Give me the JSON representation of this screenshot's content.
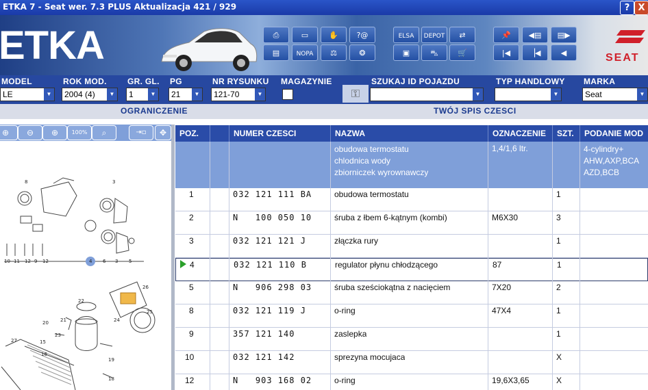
{
  "window": {
    "title": "ETKA 7 - Seat wer. 7.3 PLUS Aktualizacja 421 / 929",
    "help_button": "?",
    "close_button": "X"
  },
  "banner": {
    "logo": "ETKA",
    "brand": "SEAT",
    "icons": {
      "nopa": "NOPA",
      "elsa": "ELSA",
      "depot": "DEPOT"
    }
  },
  "filters": {
    "model": {
      "label": "MODEL",
      "value": "LE"
    },
    "year": {
      "label": "ROK MOD.",
      "value": "2004 (4)"
    },
    "main_group": {
      "label": "GR. GL.",
      "value": "1"
    },
    "sub_group": {
      "label": "PG",
      "value": "21"
    },
    "drawing": {
      "label": "NR RYSUNKU",
      "value": "121-70"
    },
    "warehouse": {
      "label": "MAGAZYNIE"
    },
    "vehicle_id": {
      "label": "SZUKAJ ID POJAZDU",
      "value": ""
    },
    "trade_type": {
      "label": "TYP HANDLOWY",
      "value": ""
    },
    "brand": {
      "label": "MARKA",
      "value": "Seat"
    }
  },
  "subbar": {
    "left": "OGRANICZENIE",
    "right": "TWÓJ SPIS CZESCI"
  },
  "table": {
    "headers": {
      "pos": "POZ.",
      "part_no": "NUMER CZESCI",
      "name": "NAZWA",
      "designation": "OZNACZENIE",
      "qty": "SZT.",
      "model_info": "PODANIE MOD"
    },
    "group_header": {
      "name_lines": [
        "obudowa termostatu",
        "chlodnica wody",
        "zbiorniczek wyrownawczy"
      ],
      "designation": "1,4/1,6 ltr.",
      "model_lines": [
        "4-cylindry+",
        "AHW,AXP,BCA",
        "AZD,BCB"
      ]
    },
    "rows": [
      {
        "pos": "1",
        "part_no": "032 121 111 BA",
        "name": "obudowa termostatu",
        "designation": "",
        "qty": "1"
      },
      {
        "pos": "2",
        "part_no": "N   100 050 10",
        "name": "śruba z łbem 6-kątnym (kombi)",
        "designation": "M6X30",
        "qty": "3"
      },
      {
        "pos": "3",
        "part_no": "032 121 121 J",
        "name": "złączka rury",
        "designation": "",
        "qty": "1"
      },
      {
        "pos": "4",
        "part_no": "032 121 110 B",
        "name": "regulator płynu chłodzącego",
        "designation": "87",
        "qty": "1",
        "selected": true
      },
      {
        "pos": "5",
        "part_no": "N   906 298 03",
        "name": "śruba sześciokątna z nacięciem",
        "designation": "7X20",
        "qty": "2"
      },
      {
        "pos": "8",
        "part_no": "032 121 119 J",
        "name": "o-ring",
        "designation": "47X4",
        "qty": "1"
      },
      {
        "pos": "9",
        "part_no": "357 121 140",
        "name": "zaslepka",
        "designation": "",
        "qty": "1"
      },
      {
        "pos": "10",
        "part_no": "032 121 142",
        "name": "sprezyna mocujaca",
        "designation": "",
        "qty": "X"
      },
      {
        "pos": "12",
        "part_no": "N   903 168 02",
        "name": "o-ring",
        "designation": "19,6X3,65",
        "qty": "X"
      }
    ]
  },
  "diagram": {
    "callouts": [
      "8",
      "3",
      "10",
      "11",
      "12",
      "9",
      "12",
      "4",
      "6",
      "3",
      "5",
      "26",
      "25",
      "22",
      "21",
      "20",
      "24",
      "23",
      "27",
      "15",
      "16",
      "19",
      "18"
    ]
  },
  "colors": {
    "title_bar": "#1f44b8",
    "filter_bar": "#2748a0",
    "header": "#2a4ca8",
    "select_arrow": "#3158b8"
  }
}
